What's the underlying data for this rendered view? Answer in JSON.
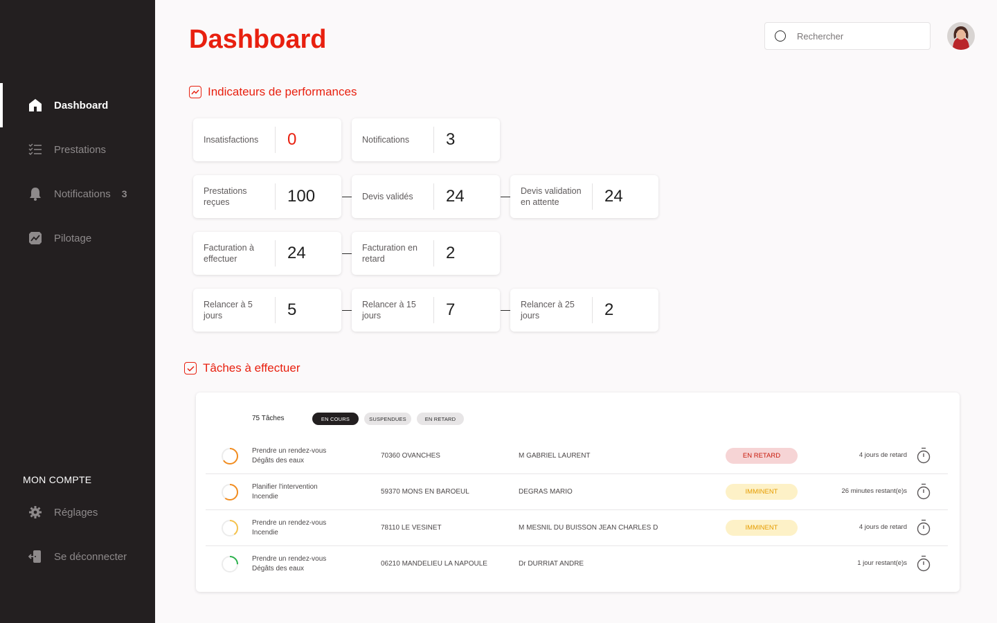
{
  "sidebar": {
    "items": [
      {
        "label": "Dashboard"
      },
      {
        "label": "Prestations"
      },
      {
        "label": "Notifications",
        "badge": "3"
      },
      {
        "label": "Pilotage"
      }
    ],
    "account_title": "MON COMPTE",
    "account_items": [
      {
        "label": "Réglages"
      },
      {
        "label": "Se déconnecter"
      }
    ]
  },
  "header": {
    "title": "Dashboard",
    "search_placeholder": "Rechercher"
  },
  "kpi_section": {
    "title": "Indicateurs de performances",
    "cards": [
      {
        "label": "Insatisfactions",
        "value": "0"
      },
      {
        "label": "Notifications",
        "value": "3"
      },
      {
        "label": "Prestations reçues",
        "value": "100"
      },
      {
        "label": "Devis validés",
        "value": "24"
      },
      {
        "label": "Devis validation en attente",
        "value": "24"
      },
      {
        "label": "Facturation à effectuer",
        "value": "24"
      },
      {
        "label": "Facturation en retard",
        "value": "2"
      },
      {
        "label": "Relancer à 5 jours",
        "value": "5"
      },
      {
        "label": "Relancer à 15 jours",
        "value": "7"
      },
      {
        "label": "Relancer à 25 jours",
        "value": "2"
      }
    ]
  },
  "tasks_section": {
    "title": "Tâches à effectuer",
    "count_label": "75 Tâches",
    "filters": [
      "EN COURS",
      "SUSPENDUES",
      "EN RETARD"
    ],
    "rows": [
      {
        "title": "Prendre un rendez-vous",
        "subtitle": "Dégâts des eaux",
        "city": "70360 OVANCHES",
        "person": "M GABRIEL LAURENT",
        "status": "EN RETARD",
        "time": "4 jours de retard",
        "progress": 0.65,
        "ring_color": "#f28c1e"
      },
      {
        "title": "Planifier l'intervention",
        "subtitle": "Incendie",
        "city": "59370 MONS EN BAROEUL",
        "person": "DEGRAS MARIO",
        "status": "IMMINENT",
        "time": "26 minutes restant(e)s",
        "progress": 0.6,
        "ring_color": "#f28c1e"
      },
      {
        "title": "Prendre un rendez-vous",
        "subtitle": "Incendie",
        "city": "78110 LE VESINET",
        "person": "M MESNIL DU BUISSON JEAN CHARLES D",
        "status": "IMMINENT",
        "time": "4 jours de retard",
        "progress": 0.4,
        "ring_color": "#f5c24b"
      },
      {
        "title": "Prendre un rendez-vous",
        "subtitle": "Dégâts des eaux",
        "city": "06210 MANDELIEU LA NAPOULE",
        "person": "Dr DURRIAT ANDRE",
        "status": "",
        "time": "1 jour restant(e)s",
        "progress": 0.25,
        "ring_color": "#2bb24c"
      }
    ]
  },
  "colors": {
    "accent": "#e8200f",
    "sidebar_bg": "#231f20",
    "late_badge_bg": "#f6d4d5",
    "imminent_badge_bg": "#fdf1c7"
  }
}
